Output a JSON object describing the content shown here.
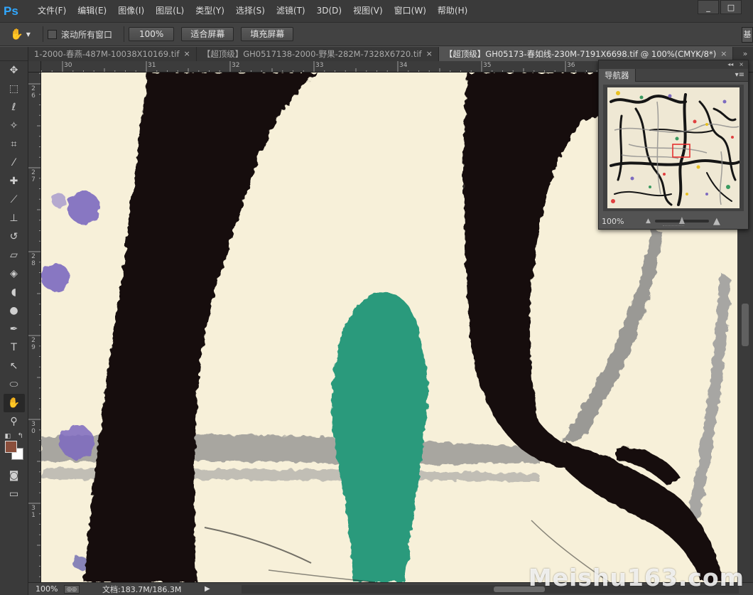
{
  "app": {
    "logo": "Ps",
    "menus": [
      "文件(F)",
      "编辑(E)",
      "图像(I)",
      "图层(L)",
      "类型(Y)",
      "选择(S)",
      "滤镜(T)",
      "3D(D)",
      "视图(V)",
      "窗口(W)",
      "帮助(H)"
    ],
    "window_controls": [
      "_",
      "□"
    ]
  },
  "options_bar": {
    "tool_icon": "hand-icon",
    "scroll_all_label": "滚动所有窗口",
    "scroll_all_checked": false,
    "btn_100": "100%",
    "btn_fit": "适合屏幕",
    "btn_fill": "填充屏幕",
    "right_button": "基"
  },
  "tabs": [
    {
      "label": "1-2000-春燕-487M-10038X10169.tif",
      "close": "×",
      "active": false
    },
    {
      "label": "【超顶级】GH0517138-2000-野果-282M-7328X6720.tif",
      "close": "×",
      "active": false
    },
    {
      "label": "【超顶级】GH05173-春如线-230M-7191X6698.tif @ 100%(CMYK/8*)",
      "close": "×",
      "active": true
    }
  ],
  "tabs_more": "»",
  "ruler": {
    "top": [
      "30",
      "31",
      "32",
      "33",
      "34",
      "35",
      "36"
    ],
    "left": [
      "26",
      "27",
      "28",
      "29",
      "30",
      "31"
    ]
  },
  "toolbox": {
    "tools": [
      {
        "name": "move-tool",
        "glyph": "✥"
      },
      {
        "name": "marquee-tool",
        "glyph": "⬚"
      },
      {
        "name": "lasso-tool",
        "glyph": "ℓ"
      },
      {
        "name": "magic-wand-tool",
        "glyph": "✧"
      },
      {
        "name": "crop-tool",
        "glyph": "⌗"
      },
      {
        "name": "eyedropper-tool",
        "glyph": "⁄"
      },
      {
        "name": "healing-brush-tool",
        "glyph": "✚"
      },
      {
        "name": "brush-tool",
        "glyph": "⟋"
      },
      {
        "name": "clone-stamp-tool",
        "glyph": "⊥"
      },
      {
        "name": "history-brush-tool",
        "glyph": "↺"
      },
      {
        "name": "eraser-tool",
        "glyph": "▱"
      },
      {
        "name": "paint-bucket-tool",
        "glyph": "◈"
      },
      {
        "name": "blur-tool",
        "glyph": "◖"
      },
      {
        "name": "dodge-tool",
        "glyph": "●"
      },
      {
        "name": "pen-tool",
        "glyph": "✒"
      },
      {
        "name": "type-tool",
        "glyph": "T"
      },
      {
        "name": "path-selection-tool",
        "glyph": "↖"
      },
      {
        "name": "ellipse-tool",
        "glyph": "⬭"
      },
      {
        "name": "hand-tool",
        "glyph": "✋",
        "active": true
      },
      {
        "name": "zoom-tool",
        "glyph": "⚲"
      }
    ],
    "foreground_color": "#8b4f3c",
    "background_color": "#ffffff",
    "extra_tools": [
      {
        "name": "quick-mask-tool",
        "glyph": "◙"
      },
      {
        "name": "screen-mode-tool",
        "glyph": "▭"
      }
    ]
  },
  "navigator": {
    "title": "导航器",
    "menu_glyph": "▾≡",
    "collapse_glyph": "◂◂",
    "close_glyph": "×",
    "zoom": "100%",
    "zoom_out_glyph": "▲",
    "zoom_in_glyph": "▲",
    "slider_value": 0.5,
    "view_box_color": "#e53030"
  },
  "status": {
    "zoom": "100%",
    "doc_info": "文档:183.7M/186.3M",
    "arrow": "▶"
  },
  "watermark": "Meishu163.com",
  "colors": {
    "paper": "#f7f0d9",
    "ink": "#121010",
    "teal": "#2a9a7c",
    "purple": "#7d6bc0",
    "grey_stroke": "#8a8a8a"
  }
}
